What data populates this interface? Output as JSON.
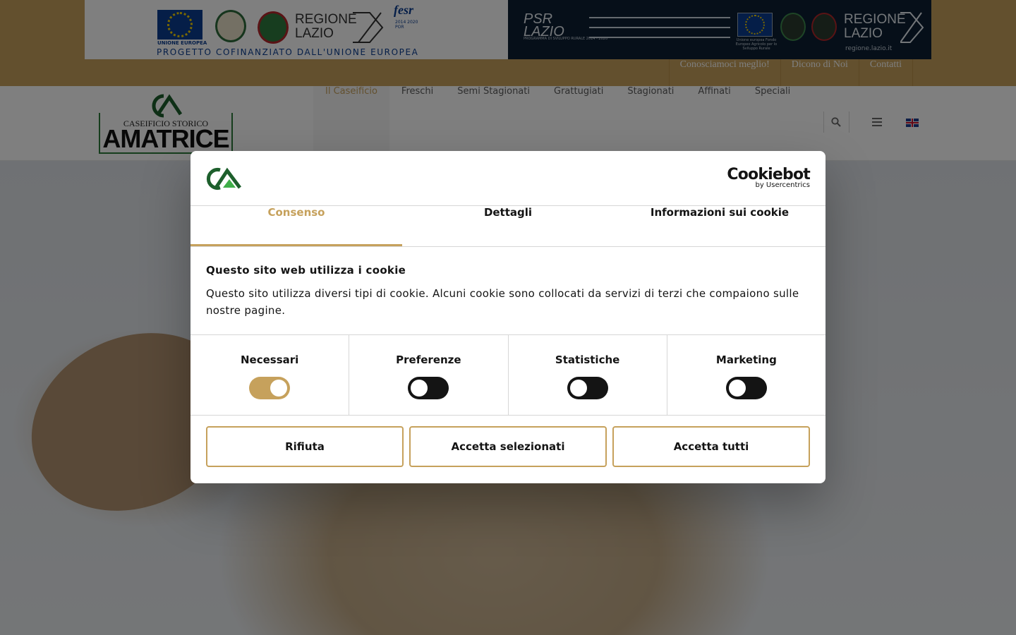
{
  "banner": {
    "eu_caption": "UNIONE EUROPEA",
    "regione_line1": "REGIONE",
    "regione_line2": "LAZIO",
    "fesr": "fesr",
    "fesr_sub": "2014 2020 POR",
    "progetto": "PROGETTO COFINANZIATO DALL'UNIONE EUROPEA",
    "psr_line1": "PSR",
    "psr_line2": "LAZIO",
    "psr_sub": "PROGRAMMA DI SVILUPPO RURALE 2014 - 2020",
    "eu_caption2": "Unione europea Fondo Europeo Agricolo per lo Sviluppo Rurale",
    "regione2_line1": "REGIONE",
    "regione2_line2": "LAZIO",
    "regione_url": "regione.lazio.it"
  },
  "topnav": [
    "Conosciamoci meglio!",
    "Dicono di Noi",
    "Contatti"
  ],
  "logo": {
    "line1": "CASEIFICIO STORICO",
    "line2": "AMATRICE"
  },
  "mainnav": [
    "Il Caseificio",
    "Freschi",
    "Semi Stagionati",
    "Grattugiati",
    "Stagionati",
    "Affinati",
    "Speciali"
  ],
  "mainnav_active": "Il Caseificio",
  "icons": {
    "search": "search-icon",
    "menu": "menu-icon",
    "language": "uk-flag-icon"
  },
  "cookie_dialog": {
    "brand": "Cookiebot",
    "brand_sub": "by Usercentrics",
    "tabs": [
      "Consenso",
      "Dettagli",
      "Informazioni sui cookie"
    ],
    "active_tab": "Consenso",
    "title": "Questo sito web utilizza i cookie",
    "text": "Questo sito utilizza diversi tipi di cookie. Alcuni cookie sono collocati da servizi di terzi che compaiono sulle nostre pagine.",
    "toggles": [
      {
        "label": "Necessari",
        "on": true
      },
      {
        "label": "Preferenze",
        "on": false
      },
      {
        "label": "Statistiche",
        "on": false
      },
      {
        "label": "Marketing",
        "on": false
      }
    ],
    "buttons": {
      "reject": "Rifiuta",
      "accept_selected": "Accetta selezionati",
      "accept_all": "Accetta tutti"
    }
  },
  "colors": {
    "accent": "#c6a15c",
    "text": "#141414",
    "toggle_off": "#141414",
    "banner_dark": "#0d1f33"
  }
}
